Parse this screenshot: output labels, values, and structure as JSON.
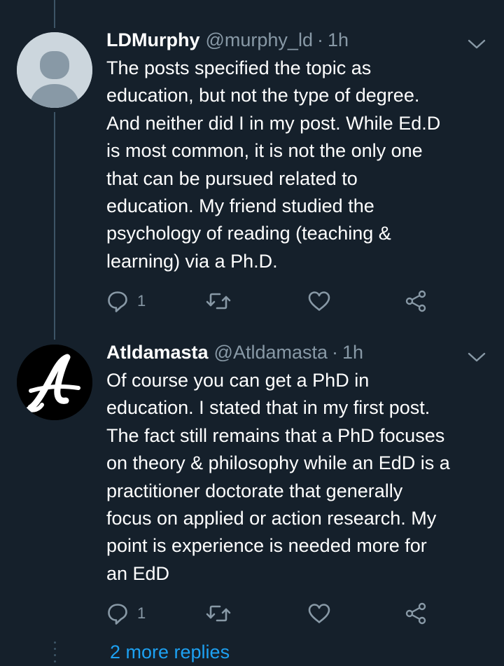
{
  "thread": {
    "more_replies_label": "2 more replies"
  },
  "tweets": [
    {
      "name": "LDMurphy",
      "handle": "@murphy_ld",
      "separator": "·",
      "time": "1h",
      "text": "The posts specified the topic as\neducation, but not the type of degree.\nAnd neither did I in my post.  While Ed.D\nis most common, it is not the only one\nthat can be pursued related to\neducation.  My friend studied the\npsychology of reading (teaching &\nlearning) via a Ph.D.",
      "reply_count": "1",
      "avatar": "default-profile-silhouette"
    },
    {
      "name": "Atldamasta",
      "handle": "@Atldamasta",
      "separator": "·",
      "time": "1h",
      "text": "Of course you can get a PhD in\neducation. I stated that in my first post.\nThe fact still remains that a PhD focuses\non theory & philosophy while an EdD is a\npractitioner doctorate that generally\nfocus on applied or action research. My\npoint is experience is needed more for\nan EdD",
      "reply_count": "1",
      "avatar": "script-letter-a-logo"
    }
  ],
  "icons": {
    "reply": "reply-icon",
    "retweet": "retweet-icon",
    "like": "like-icon",
    "share": "share-icon",
    "menu": "chevron-down-icon"
  },
  "colors": {
    "background": "#15202b",
    "primary_text": "#ffffff",
    "secondary_text": "#8899a6",
    "link": "#1da1f2",
    "thread_line": "#3d5466"
  }
}
